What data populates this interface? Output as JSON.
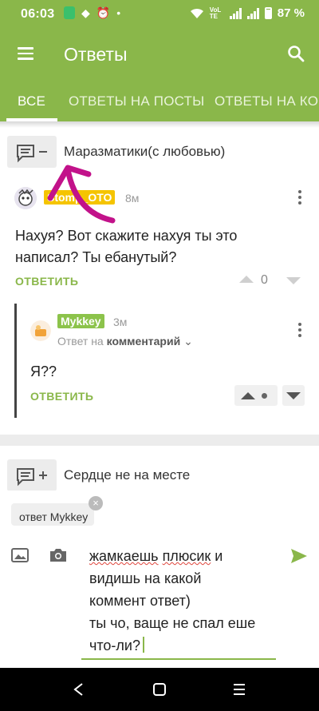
{
  "status_bar": {
    "time": "06:03",
    "battery": "87 %",
    "network_label": "VoLTE"
  },
  "app_bar": {
    "title": "Ответы",
    "menu_icon": "menu-icon",
    "search_icon": "search-icon"
  },
  "tabs": [
    {
      "label": "ВСЕ",
      "active": true
    },
    {
      "label": "ОТВЕТЫ НА ПОСТЫ",
      "active": false
    },
    {
      "label": "ОТВЕТЫ НА КО",
      "active": false
    }
  ],
  "posts": [
    {
      "title": "Маразматики(с любовью)",
      "toggle_icon": "comments-collapse-icon",
      "comments": [
        {
          "author": "Stomp_OTO",
          "time": "8м",
          "text_lines": [
            "Нахуя? Вот скажите нахуя ты это",
            "написал? Ты ебанутый?"
          ],
          "reply_label": "ОТВЕТИТЬ",
          "score": "0"
        },
        {
          "author": "Mykkey",
          "time": "3м",
          "meta_prefix": "Ответ на",
          "meta_link": "комментарий",
          "text": "Я??",
          "reply_label": "ОТВЕТИТЬ"
        }
      ]
    },
    {
      "title": "Сердце не на месте",
      "toggle_icon": "comments-expand-icon"
    }
  ],
  "composer": {
    "reply_to": "ответ Mykkey",
    "text_lines": [
      [
        "жамкаешь",
        " ",
        "плюсик",
        " и"
      ],
      "видишь на какой",
      "коммент ответ)",
      "ты чо, ваще не спал еше",
      "что-ли?"
    ],
    "image_icon": "image-icon",
    "camera_icon": "camera-icon",
    "send_icon": "send-icon"
  },
  "colors": {
    "brand_green": "#8ab74a",
    "badge_yellow": "#f5c400",
    "badge_green": "#8cc34b",
    "annotation_magenta": "#c2128a"
  }
}
